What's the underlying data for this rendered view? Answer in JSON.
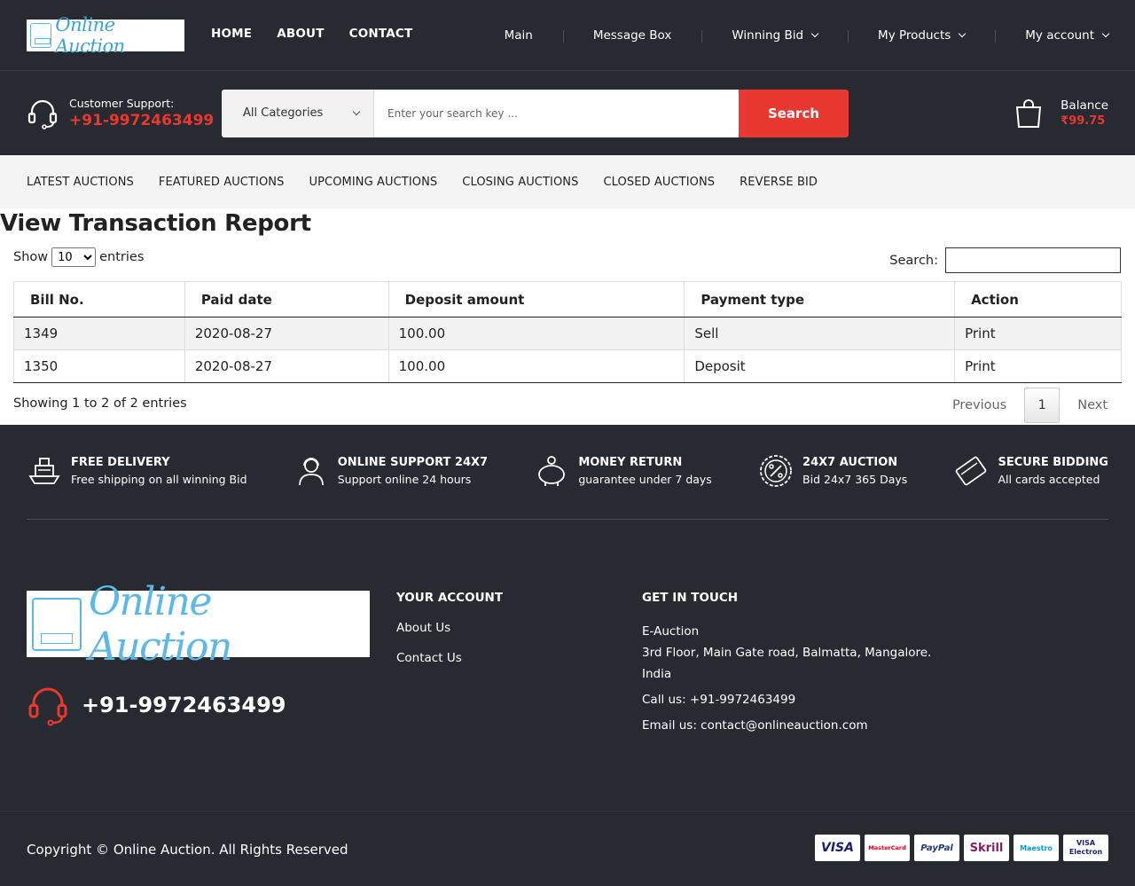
{
  "header": {
    "logo_text": "Online Auction",
    "nav": [
      "HOME",
      "ABOUT",
      "CONTACT"
    ],
    "right_nav": [
      {
        "label": "Main",
        "dropdown": false
      },
      {
        "label": "Message Box",
        "dropdown": false
      },
      {
        "label": "Winning Bid",
        "dropdown": true
      },
      {
        "label": "My Products",
        "dropdown": true
      },
      {
        "label": "My account",
        "dropdown": true
      }
    ]
  },
  "midbar": {
    "support_label": "Customer Support:",
    "support_phone": "+91-9972463499",
    "category_selected": "All Categories",
    "search_placeholder": "Enter your search key ...",
    "search_button": "Search",
    "balance_label": "Balance",
    "balance_amount": "₹99.75"
  },
  "catnav": [
    "LATEST AUCTIONS",
    "FEATURED AUCTIONS",
    "UPCOMING AUCTIONS",
    "CLOSING AUCTIONS",
    "CLOSED AUCTIONS",
    "REVERSE BID"
  ],
  "report": {
    "title": "View Transaction Report",
    "show_label": "Show",
    "entries_label": "entries",
    "entries_value": "10",
    "search_label": "Search:",
    "columns": [
      "Bill No.",
      "Paid date",
      "Deposit amount",
      "Payment type",
      "Action"
    ],
    "rows": [
      [
        "1349",
        "2020-08-27",
        "100.00",
        "Sell",
        "Print"
      ],
      [
        "1350",
        "2020-08-27",
        "100.00",
        "Deposit",
        "Print"
      ]
    ],
    "info": "Showing 1 to 2 of 2 entries",
    "pager": {
      "prev": "Previous",
      "current": "1",
      "next": "Next"
    }
  },
  "footer": {
    "features": [
      {
        "title": "FREE DELIVERY",
        "sub": "Free shipping on all winning Bid",
        "icon": "ship-icon"
      },
      {
        "title": "ONLINE SUPPORT 24X7",
        "sub": "Support online 24 hours",
        "icon": "support-agent-icon"
      },
      {
        "title": "MONEY RETURN",
        "sub": "guarantee under 7 days",
        "icon": "piggy-bank-icon"
      },
      {
        "title": "24X7 AUCTION",
        "sub": "Bid 24x7 365 Days",
        "icon": "percent-badge-icon"
      },
      {
        "title": "SECURE BIDDING",
        "sub": "All cards accepted",
        "icon": "credit-card-icon"
      }
    ],
    "logo_text": "Online Auction",
    "phone": "+91-9972463499",
    "account_title": "YOUR ACCOUNT",
    "account_links": [
      "About Us",
      "Contact Us"
    ],
    "touch_title": "GET IN TOUCH",
    "touch_company": "E-Auction",
    "touch_address1": "3rd Floor, Main Gate road, Balmatta, Mangalore.",
    "touch_address2": "India",
    "touch_call": "Call us: +91-9972463499",
    "touch_email": "Email us: contact@onlineauction.com",
    "copyright": "Copyright © Online Auction. All Rights Reserved",
    "payments": [
      {
        "label": "VISA",
        "color": "#1a1f71"
      },
      {
        "label": "MasterCard",
        "color": "#eb001b"
      },
      {
        "label": "PayPal",
        "color": "#253b80"
      },
      {
        "label": "Skrill",
        "color": "#862165"
      },
      {
        "label": "Maestro",
        "color": "#0099df"
      },
      {
        "label": "VISA Electron",
        "color": "#1a1f71"
      }
    ]
  },
  "colors": {
    "accent": "#e8382f",
    "dark_bg": "#272a30",
    "logo_blue": "#3ca4dc"
  }
}
